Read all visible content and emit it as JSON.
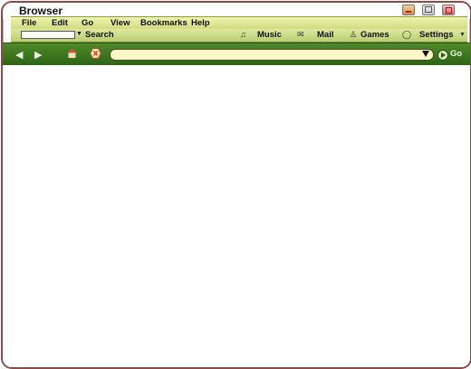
{
  "window": {
    "title": "Browser"
  },
  "menu": {
    "items": [
      "File",
      "Edit",
      "Go",
      "View",
      "Bookmarks",
      "Help"
    ]
  },
  "toolbar": {
    "search_label": "Search",
    "search_value": "",
    "links": [
      {
        "label": "Music",
        "icon": "music-icon"
      },
      {
        "label": "Mail",
        "icon": "mail-icon"
      },
      {
        "label": "Games",
        "icon": "games-icon"
      },
      {
        "label": "Settings",
        "icon": "settings-icon"
      }
    ]
  },
  "navigation": {
    "address_value": "",
    "go_label": "Go"
  },
  "colors": {
    "menubar": "#dbe7a0",
    "navbar": "#3f7a22",
    "address_bg": "#fff7c8",
    "window_border": "#8a4a48"
  }
}
